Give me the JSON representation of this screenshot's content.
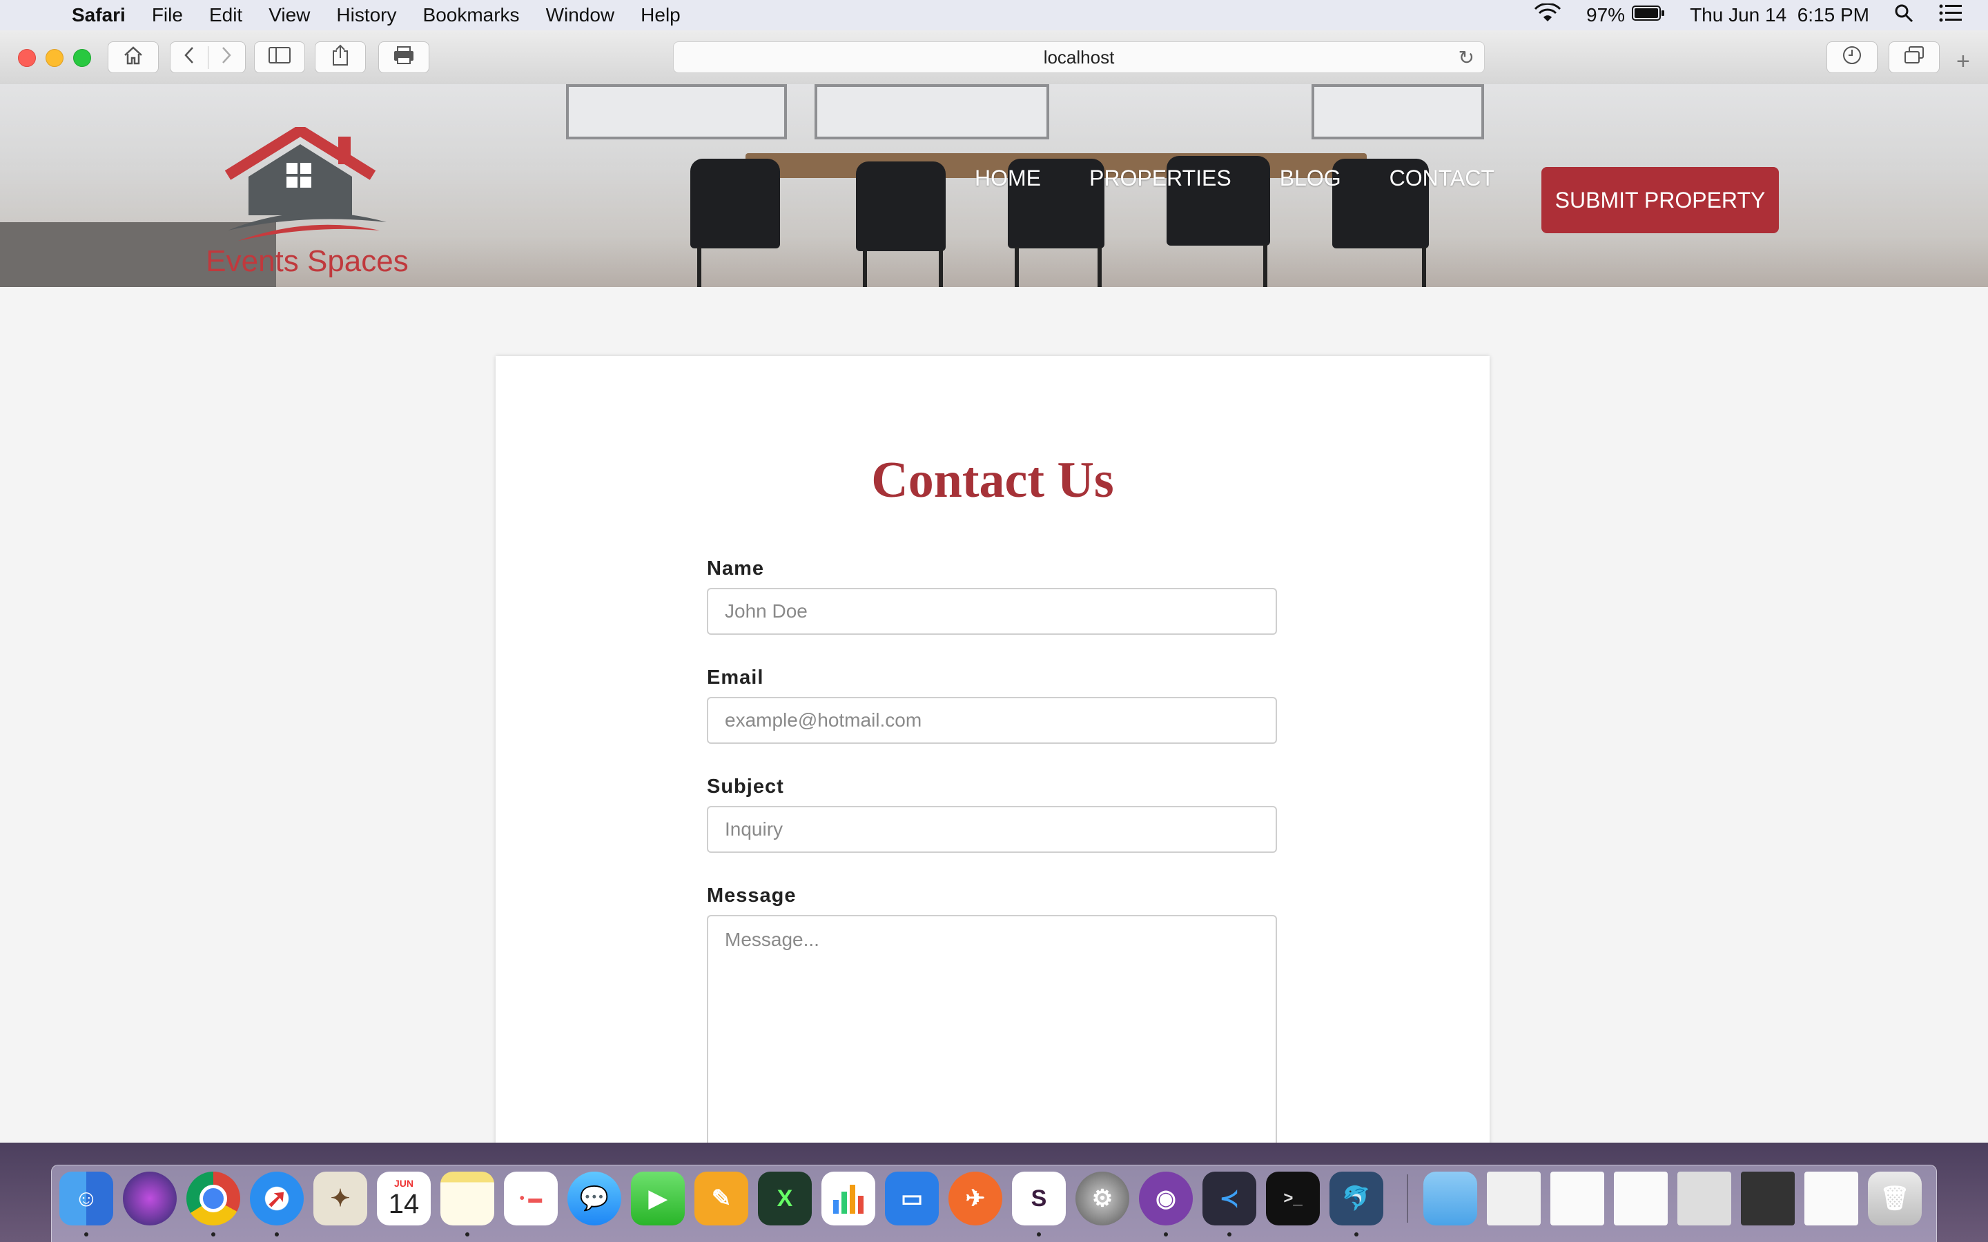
{
  "menubar": {
    "app": "Safari",
    "items": [
      "File",
      "Edit",
      "View",
      "History",
      "Bookmarks",
      "Window",
      "Help"
    ],
    "battery": "97%",
    "datetime": "Thu Jun 14  6:15 PM"
  },
  "browser": {
    "url": "localhost"
  },
  "site": {
    "logo_text": "Events Spaces",
    "nav": [
      "HOME",
      "PROPERTIES",
      "BLOG",
      "CONTACT"
    ],
    "submit_label": "SUBMIT PROPERTY",
    "brand_color": "#ad2f37"
  },
  "contact_form": {
    "title": "Contact Us",
    "name_label": "Name",
    "name_placeholder": "John Doe",
    "email_label": "Email",
    "email_placeholder": "example@hotmail.com",
    "subject_label": "Subject",
    "subject_placeholder": "Inquiry",
    "message_label": "Message",
    "message_placeholder": "Message..."
  },
  "dock": {
    "calendar_month": "JUN",
    "calendar_day": "14",
    "apps": [
      "finder-icon",
      "siri-icon",
      "chrome-icon",
      "safari-icon",
      "preview-icon",
      "calendar-icon",
      "notes-icon",
      "reminders-icon",
      "messages-icon",
      "facetime-icon",
      "pages-icon",
      "xcode-icon",
      "numbers-icon",
      "keynote-icon",
      "postman-icon",
      "slack-icon",
      "system-preferences-icon",
      "github-desktop-icon",
      "vscode-icon",
      "terminal-icon",
      "mysql-workbench-icon",
      "folder-icon",
      "trash-icon"
    ]
  }
}
